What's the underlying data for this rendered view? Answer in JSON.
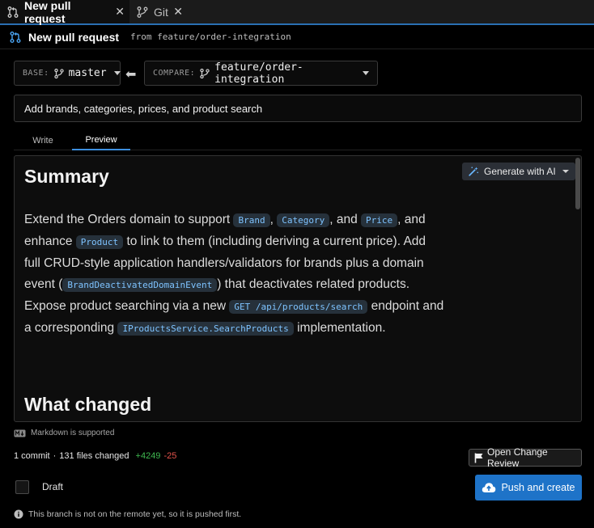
{
  "tabs": [
    {
      "label": "New pull request",
      "icon": "pull-request-icon",
      "active": true
    },
    {
      "label": "Git",
      "icon": "git-branch-icon",
      "active": false
    }
  ],
  "header": {
    "title": "New pull request",
    "from_text": "from feature/order-integration"
  },
  "base": {
    "label": "BASE:",
    "value": "master"
  },
  "compare": {
    "label": "COMPARE:",
    "value": "feature/order-integration"
  },
  "pr_title": {
    "value": "Add brands, categories, prices, and product search"
  },
  "mode_tabs": {
    "write": "Write",
    "preview": "Preview",
    "selected": "Preview"
  },
  "preview": {
    "heading1": "Summary",
    "heading2": "What changed",
    "generate_label": "Generate with AI",
    "para": {
      "t1": "Extend the Orders domain to support ",
      "c1": "Brand",
      "t2": ", ",
      "c2": "Category",
      "t3": ", and ",
      "c3": "Price",
      "t4": ", and enhance ",
      "c4": "Product",
      "t5": " to link to them (including deriving a current price). Add full CRUD-style application handlers/validators for brands plus a domain event (",
      "c5": "BrandDeactivatedDomainEvent",
      "t6": ") that deactivates related products. Expose product searching via a new ",
      "c6": "GET /api/products/search",
      "t7": " endpoint and a corresponding ",
      "c7": "IProductsService.SearchProducts",
      "t8": " implementation."
    }
  },
  "markdown_note": "Markdown is supported",
  "stats": {
    "commits": "1 commit",
    "separator": "·",
    "files": "131 files changed",
    "additions": "+4249",
    "deletions": "-25"
  },
  "open_review_label": "Open Change Review",
  "draft": {
    "label": "Draft",
    "checked": false
  },
  "push_label": "Push and create",
  "info_text": "This branch is not on the remote yet, so it is pushed first.",
  "colors": {
    "accent": "#1e73c8",
    "additions": "#3fb950",
    "deletions": "#e5534b",
    "code": "#7ec3ff"
  }
}
